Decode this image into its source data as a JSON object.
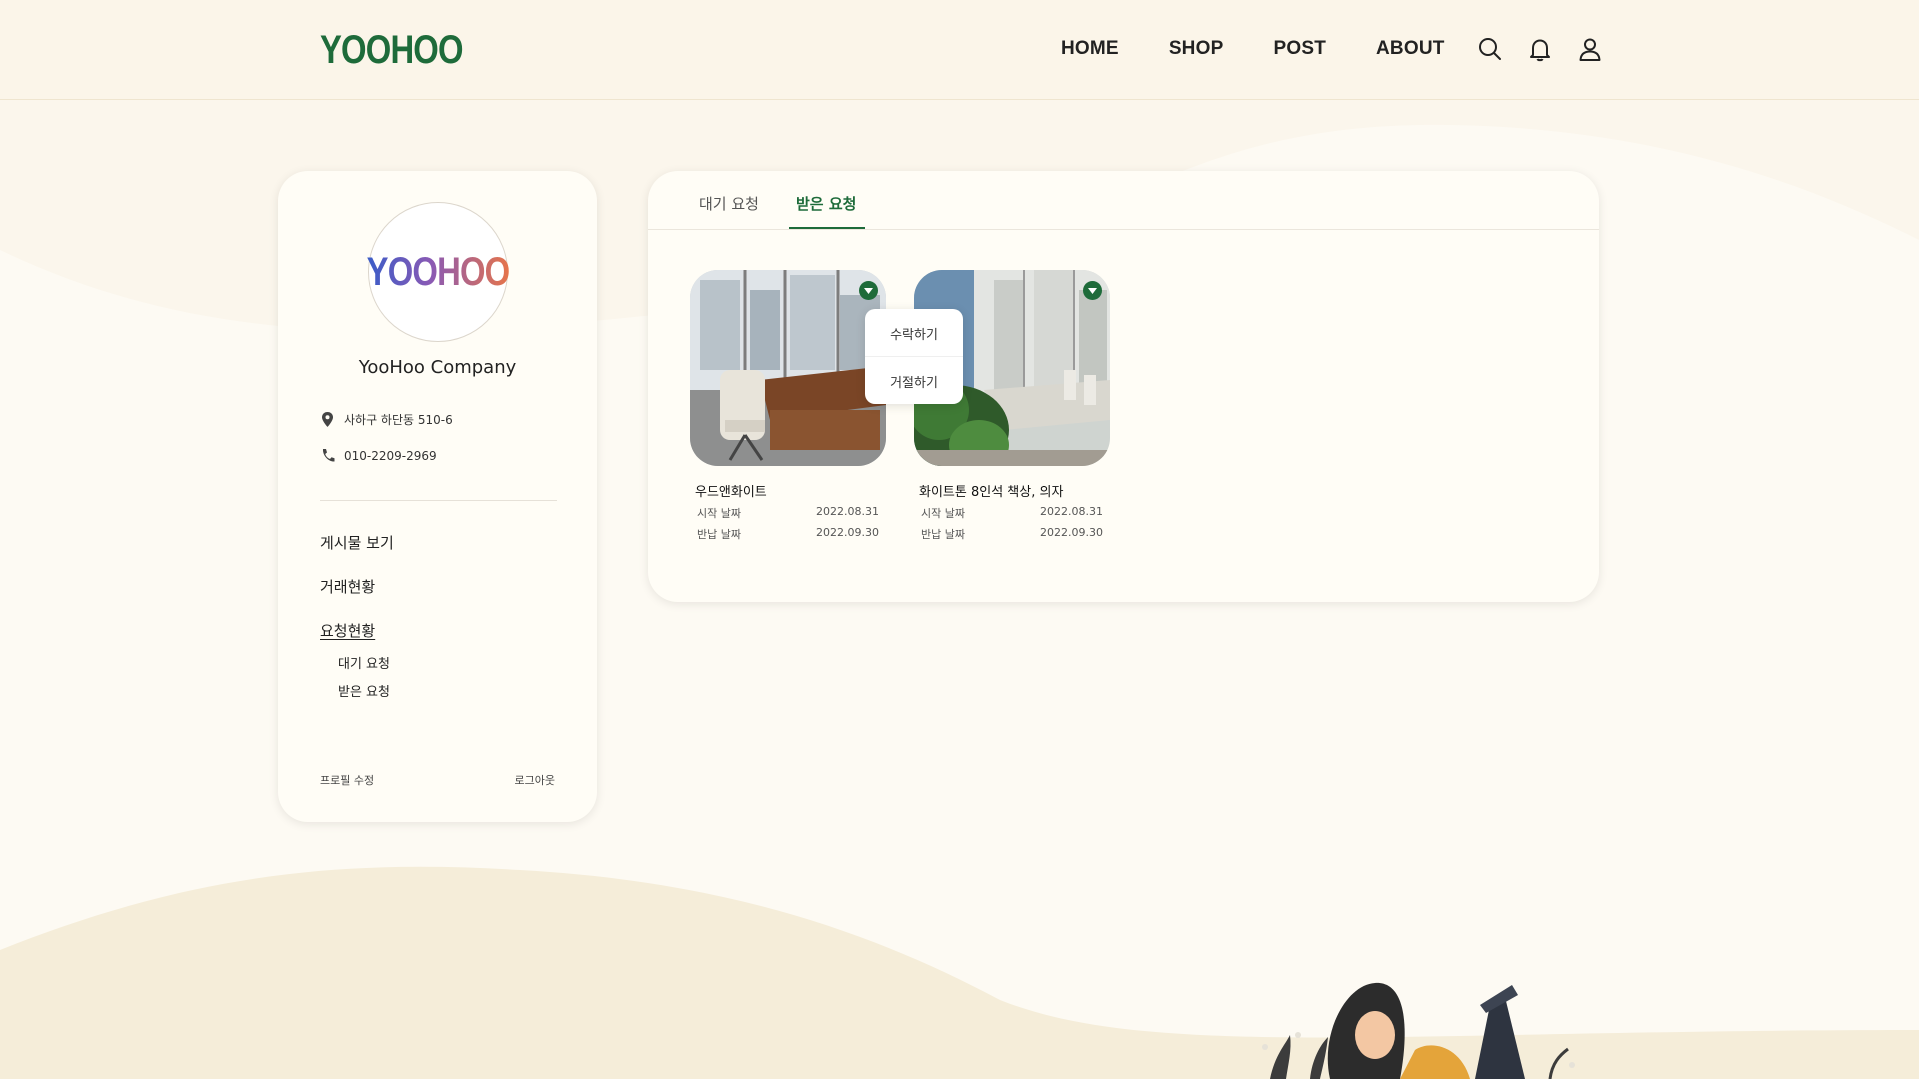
{
  "header": {
    "logo": "YOOHOO",
    "nav": [
      "HOME",
      "SHOP",
      "POST",
      "ABOUT"
    ],
    "icons": [
      "search-icon",
      "bell-icon",
      "user-icon"
    ]
  },
  "profile": {
    "avatar_logo": "YOOHOO",
    "company_name": "YooHoo Company",
    "address": "사하구 하단동 510-6",
    "phone": "010-2209-2969",
    "menu": {
      "posts": "게시물 보기",
      "transactions": "거래현황",
      "requests": "요청현황",
      "sub_pending": "대기 요청",
      "sub_received": "받은 요청"
    },
    "edit_profile": "프로필 수정",
    "logout": "로그아웃"
  },
  "main": {
    "tabs": [
      "대기 요청",
      "받은 요청"
    ],
    "active_tab": "받은 요청",
    "items": [
      {
        "title": "우드앤화이트",
        "start_label": "시작 날짜",
        "start_date": "2022.08.31",
        "return_label": "반납 날짜",
        "return_date": "2022.09.30"
      },
      {
        "title": "화이트톤 8인석 책상, 의자",
        "start_label": "시작 날짜",
        "start_date": "2022.08.31",
        "return_label": "반납 날짜",
        "return_date": "2022.09.30"
      }
    ],
    "dropdown": {
      "accept": "수락하기",
      "reject": "거절하기"
    }
  },
  "colors": {
    "brand_green": "#1e6b3a",
    "background": "#fbf6ec",
    "card": "#fffdf6"
  }
}
